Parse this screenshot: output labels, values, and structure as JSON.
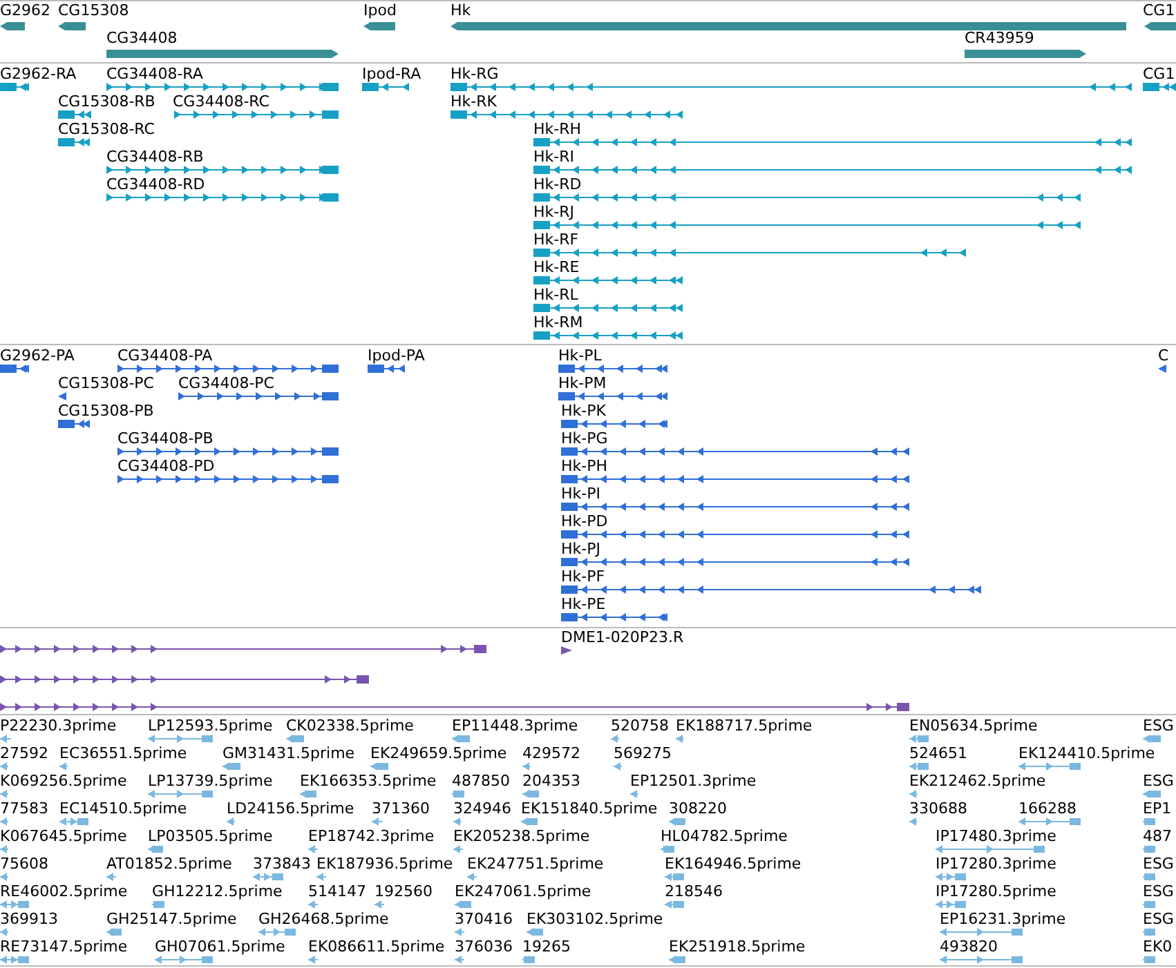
{
  "tracks": [
    {
      "kind": "gene",
      "features": [
        {
          "label": "G2962",
          "reverse": true
        },
        {
          "label": "CG15308",
          "reverse": true
        },
        {
          "label": "Ipod",
          "reverse": true
        },
        {
          "label": "Hk",
          "reverse": true
        },
        {
          "label": "CG1",
          "reverse": true
        },
        {
          "label": "CG34408",
          "reverse": false
        },
        {
          "label": "CR43959",
          "reverse": false
        }
      ]
    },
    {
      "kind": "transcript",
      "features": [
        {
          "label": "G2962-RA",
          "reverse": true
        },
        {
          "label": "CG34408-RA",
          "reverse": false
        },
        {
          "label": "Ipod-RA",
          "reverse": true
        },
        {
          "label": "Hk-RG",
          "reverse": true
        },
        {
          "label": "CG1",
          "reverse": true
        },
        {
          "label": "CG15308-RB",
          "reverse": true
        },
        {
          "label": "CG34408-RC",
          "reverse": false
        },
        {
          "label": "Hk-RK",
          "reverse": true
        },
        {
          "label": "CG15308-RC",
          "reverse": true
        },
        {
          "label": "Hk-RH",
          "reverse": true
        },
        {
          "label": "CG34408-RB",
          "reverse": false
        },
        {
          "label": "Hk-RI",
          "reverse": true
        },
        {
          "label": "CG34408-RD",
          "reverse": false
        },
        {
          "label": "Hk-RD",
          "reverse": true
        },
        {
          "label": "Hk-RJ",
          "reverse": true
        },
        {
          "label": "Hk-RF",
          "reverse": true
        },
        {
          "label": "Hk-RE",
          "reverse": true
        },
        {
          "label": "Hk-RL",
          "reverse": true
        },
        {
          "label": "Hk-RM",
          "reverse": true
        }
      ]
    },
    {
      "kind": "protein",
      "features": [
        {
          "label": "G2962-PA",
          "reverse": true
        },
        {
          "label": "CG34408-PA",
          "reverse": false
        },
        {
          "label": "Ipod-PA",
          "reverse": true
        },
        {
          "label": "Hk-PL",
          "reverse": true
        },
        {
          "label": "C",
          "reverse": true
        },
        {
          "label": "CG15308-PC",
          "reverse": true
        },
        {
          "label": "CG34408-PC",
          "reverse": false
        },
        {
          "label": "Hk-PM",
          "reverse": true
        },
        {
          "label": "CG15308-PB",
          "reverse": true
        },
        {
          "label": "Hk-PK",
          "reverse": true
        },
        {
          "label": "CG34408-PB",
          "reverse": false
        },
        {
          "label": "Hk-PG",
          "reverse": true
        },
        {
          "label": "CG34408-PD",
          "reverse": false
        },
        {
          "label": "Hk-PH",
          "reverse": true
        },
        {
          "label": "Hk-PI",
          "reverse": true
        },
        {
          "label": "Hk-PD",
          "reverse": true
        },
        {
          "label": "Hk-PJ",
          "reverse": true
        },
        {
          "label": "Hk-PF",
          "reverse": true
        },
        {
          "label": "Hk-PE",
          "reverse": true
        }
      ]
    },
    {
      "kind": "clone",
      "features": [
        {
          "label": "DME1-020P23.R",
          "reverse": false
        },
        {
          "reverse": false
        },
        {
          "reverse": false
        },
        {
          "reverse": false
        }
      ]
    },
    {
      "kind": "est",
      "features": [
        {
          "label": "P22230.3prime"
        },
        {
          "label": "LP12593.5prime"
        },
        {
          "label": "CK02338.5prime"
        },
        {
          "label": "EP11448.3prime"
        },
        {
          "label": "520758"
        },
        {
          "label": "EK188717.5prime"
        },
        {
          "label": "EN05634.5prime"
        },
        {
          "label": "ESG"
        },
        {
          "label": "27592"
        },
        {
          "label": "EC36551.5prime"
        },
        {
          "label": "GM31431.5prime"
        },
        {
          "label": "EK249659.5prime"
        },
        {
          "label": "429572"
        },
        {
          "label": "569275"
        },
        {
          "label": "524651"
        },
        {
          "label": "EK124410.5prime"
        },
        {
          "label": "K069256.5prime"
        },
        {
          "label": "LP13739.5prime"
        },
        {
          "label": "EK166353.5prime"
        },
        {
          "label": "487850"
        },
        {
          "label": "204353"
        },
        {
          "label": "EP12501.3prime"
        },
        {
          "label": "EK212462.5prime"
        },
        {
          "label": "ESG"
        },
        {
          "label": "77583"
        },
        {
          "label": "EC14510.5prime"
        },
        {
          "label": "LD24156.5prime"
        },
        {
          "label": "371360"
        },
        {
          "label": "324946"
        },
        {
          "label": "EK151840.5prime"
        },
        {
          "label": "308220"
        },
        {
          "label": "330688"
        },
        {
          "label": "166288"
        },
        {
          "label": "EP1"
        },
        {
          "label": "K067645.5prime"
        },
        {
          "label": "LP03505.5prime"
        },
        {
          "label": "EP18742.3prime"
        },
        {
          "label": "EK205238.5prime"
        },
        {
          "label": "HL04782.5prime"
        },
        {
          "label": "IP17480.3prime"
        },
        {
          "label": "487"
        },
        {
          "label": "75608"
        },
        {
          "label": "AT01852.5prime"
        },
        {
          "label": "373843"
        },
        {
          "label": "EK187936.5prime"
        },
        {
          "label": "EK247751.5prime"
        },
        {
          "label": "EK164946.5prime"
        },
        {
          "label": "IP17280.3prime"
        },
        {
          "label": "ESG"
        },
        {
          "label": "RE46002.5prime"
        },
        {
          "label": "GH12212.5prime"
        },
        {
          "label": "514147"
        },
        {
          "label": "192560"
        },
        {
          "label": "EK247061.5prime"
        },
        {
          "label": "218546"
        },
        {
          "label": "IP17280.5prime"
        },
        {
          "label": "ESG"
        },
        {
          "label": "369913"
        },
        {
          "label": "GH25147.5prime"
        },
        {
          "label": "GH26468.5prime"
        },
        {
          "label": "370416"
        },
        {
          "label": "EK303102.5prime"
        },
        {
          "label": "EP16231.3prime"
        },
        {
          "label": "ESG"
        },
        {
          "label": "RE73147.5prime"
        },
        {
          "label": "GH07061.5prime"
        },
        {
          "label": "EK086611.5prime"
        },
        {
          "label": "376036"
        },
        {
          "label": "19265"
        },
        {
          "label": "EK251918.5prime"
        },
        {
          "label": "493820"
        },
        {
          "label": "EK0"
        }
      ]
    }
  ]
}
